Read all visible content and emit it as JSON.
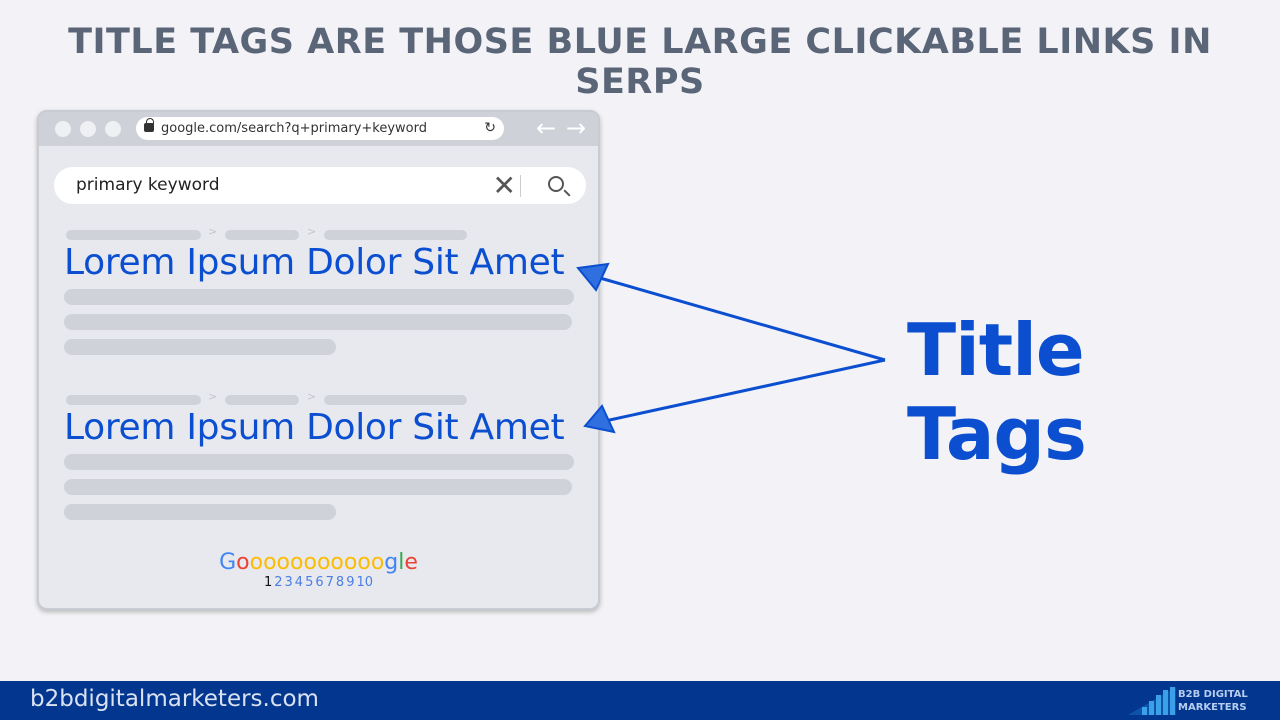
{
  "headline": "TITLE TAGS ARE THOSE BLUE LARGE CLICKABLE LINKS IN SERPS",
  "browser": {
    "url": "google.com/search?q+primary+keyword",
    "search_value": "primary keyword",
    "results": [
      {
        "title": "Lorem Ipsum Dolor Sit Amet"
      },
      {
        "title": "Lorem Ipsum Dolor Sit Amet"
      }
    ],
    "breadcrumb_separator": ">",
    "pager_logo": [
      {
        "ch": "G",
        "color": "#4285f4"
      },
      {
        "ch": "o",
        "color": "#ea4335"
      },
      {
        "ch": "o",
        "color": "#fbbc05"
      },
      {
        "ch": "o",
        "color": "#fbbc05"
      },
      {
        "ch": "o",
        "color": "#fbbc05"
      },
      {
        "ch": "o",
        "color": "#fbbc05"
      },
      {
        "ch": "o",
        "color": "#fbbc05"
      },
      {
        "ch": "o",
        "color": "#fbbc05"
      },
      {
        "ch": "o",
        "color": "#fbbc05"
      },
      {
        "ch": "o",
        "color": "#fbbc05"
      },
      {
        "ch": "o",
        "color": "#fbbc05"
      },
      {
        "ch": "o",
        "color": "#fbbc05"
      },
      {
        "ch": "g",
        "color": "#4285f4"
      },
      {
        "ch": "l",
        "color": "#34a853"
      },
      {
        "ch": "e",
        "color": "#ea4335"
      }
    ],
    "pages": [
      "1",
      "2",
      "3",
      "4",
      "5",
      "6",
      "7",
      "8",
      "9",
      "10"
    ],
    "current_page": "1"
  },
  "callout": "Title Tags",
  "accent_color": "#0b4fd0",
  "footer": {
    "site": "b2bdigitalmarketers.com",
    "logo_line1": "B2B DIGITAL",
    "logo_line2": "MARKETERS"
  }
}
